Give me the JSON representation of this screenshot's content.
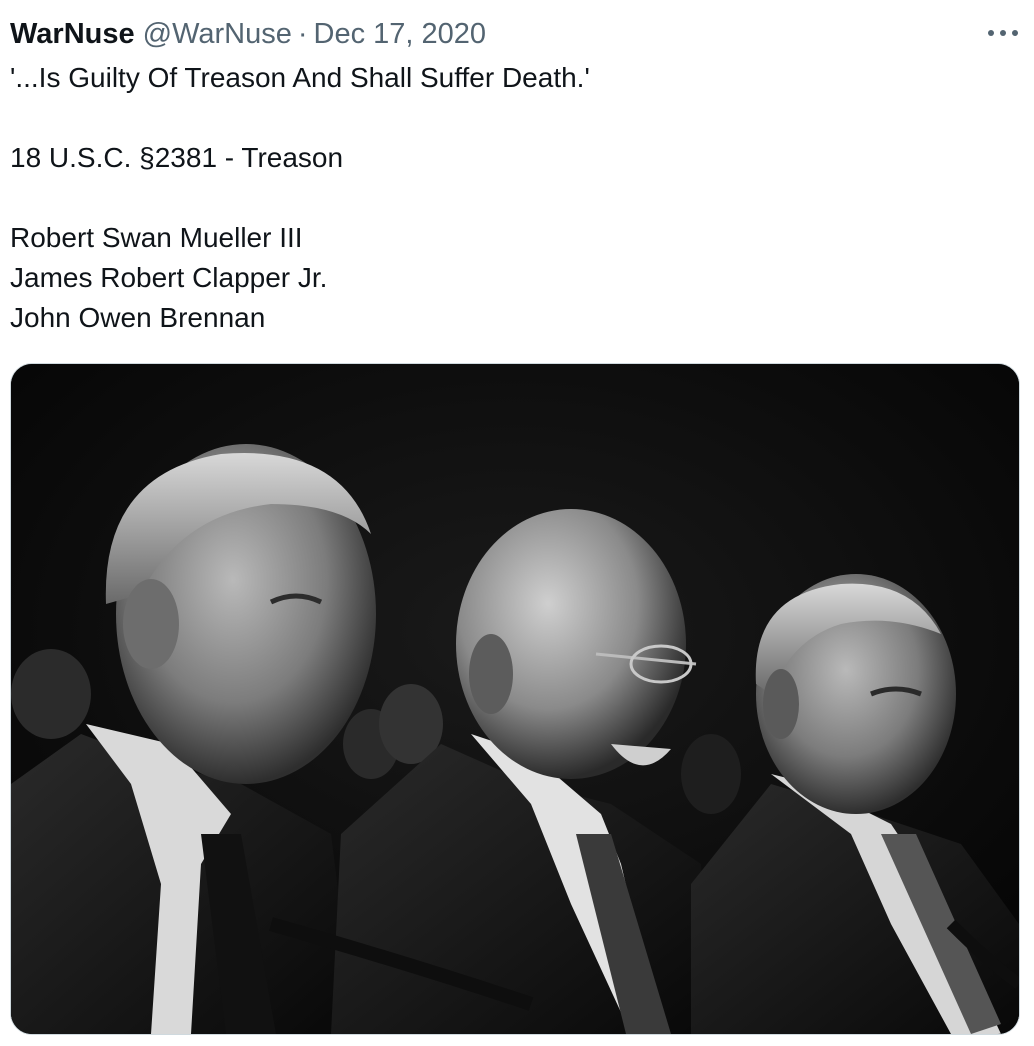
{
  "tweet": {
    "display_name": "WarNuse",
    "handle": "@WarNuse",
    "separator": "·",
    "date": "Dec 17, 2020",
    "lines": [
      "'...Is Guilty Of Treason And Shall Suffer Death.'",
      "",
      "18 U.S.C. §2381 - Treason",
      "",
      "Robert Swan Mueller III",
      "James Robert Clapper Jr.",
      "John Owen Brennan"
    ],
    "more_icon": "more-horizontal-icon"
  },
  "media": {
    "kind": "black-and-white photograph",
    "subjects": [
      "three men in suits seated at a hearing"
    ]
  },
  "colors": {
    "text": "#0f1419",
    "muted": "#536471",
    "border": "#cfd9de"
  }
}
